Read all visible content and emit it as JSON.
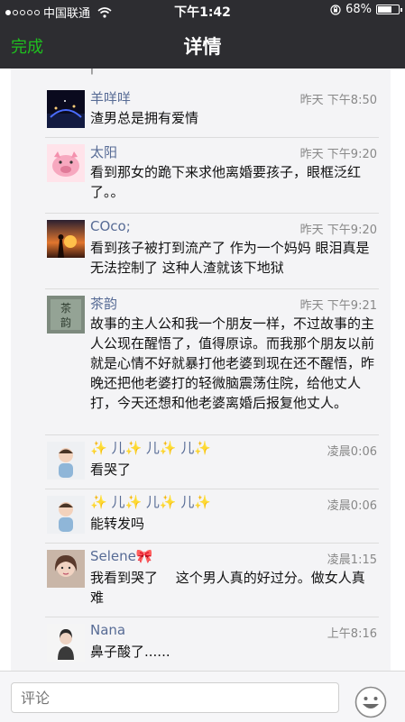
{
  "status_bar": {
    "carrier": "中国联通",
    "time": "下午1:42",
    "battery": "68%",
    "battery_level": 0.68
  },
  "nav": {
    "done_label": "完成",
    "title": "详情"
  },
  "comments": [
    {
      "name": "羊咩咩",
      "time": "昨天 下午8:50",
      "text": "渣男总是拥有爱情"
    },
    {
      "name": "太阳",
      "time": "昨天 下午9:20",
      "text": "看到那女的跪下来求他离婚要孩子，眼框泛红了。。"
    },
    {
      "name": "COco;",
      "time": "昨天 下午9:20",
      "text": "看到孩子被打到流产了 作为一个妈妈 眼泪真是无法控制了 这种人渣就该下地狱"
    },
    {
      "name": "茶韵",
      "time": "昨天 下午9:21",
      "text": "故事的主人公和我一个朋友一样，不过故事的主人公现在醒悟了，值得原谅。而我那个朋友以前就是心情不好就暴打他老婆到现在还不醒悟，昨晚还把他老婆打的轻微脑震荡住院，给他丈人打，今天还想和他老婆离婚后报复他丈人。"
    },
    {
      "name": "✨ 儿✨ 儿✨ 儿✨",
      "time": "凌晨0:06",
      "text": "看哭了"
    },
    {
      "name": "✨ 儿✨ 儿✨ 儿✨",
      "time": "凌晨0:06",
      "text": "能转发吗"
    },
    {
      "name": "Selene🎀",
      "time": "凌晨1:15",
      "text": "我看到哭了　 这个男人真的好过分。做女人真难"
    },
    {
      "name": "Nana",
      "time": "上午8:16",
      "text": "鼻子酸了......"
    }
  ],
  "footer": {
    "placeholder": "评论"
  }
}
